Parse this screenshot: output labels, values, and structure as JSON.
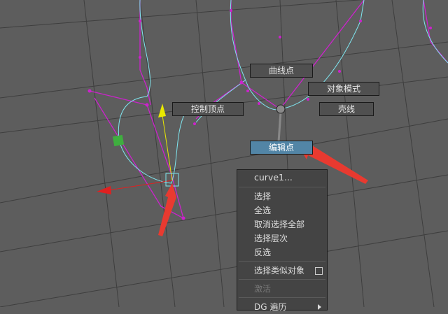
{
  "marking_menu": {
    "north": "曲线点",
    "northeast": "对象模式",
    "east": "壳线",
    "west": "控制顶点",
    "south": "编辑点"
  },
  "context_menu": {
    "title": "curve1...",
    "items": [
      "选择",
      "全选",
      "取消选择全部",
      "选择层次",
      "反选"
    ],
    "select_similar": "选择类似对象",
    "activate": "激活",
    "dg_traverse": "DG 遍历"
  },
  "colors": {
    "curve": "#7fe6f0",
    "cv": "#cc22cc",
    "highlight": "#5285a6",
    "arrow": "#e83a30"
  }
}
